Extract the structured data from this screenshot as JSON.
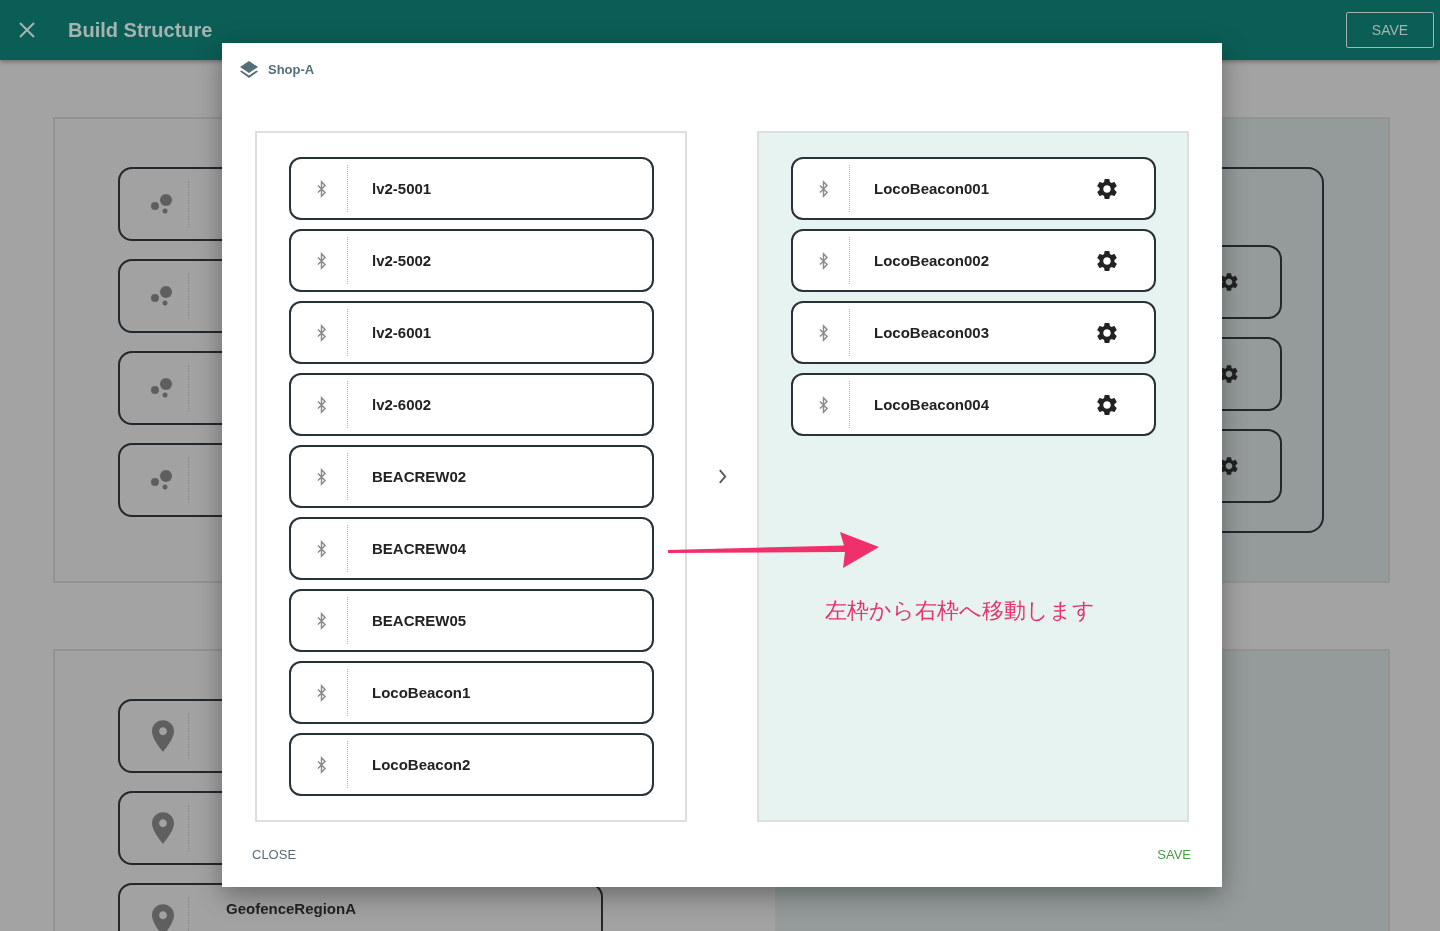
{
  "app_bar": {
    "title": "Build Structure",
    "save_button": "SAVE"
  },
  "background": {
    "group_cards": [
      {
        "kind": "group"
      },
      {
        "kind": "group"
      },
      {
        "kind": "group"
      },
      {
        "kind": "group"
      }
    ],
    "settings_cards": [
      {
        "kind": "settings"
      },
      {
        "kind": "settings"
      },
      {
        "kind": "settings"
      }
    ],
    "geofence_cards": [
      {
        "kind": "geofence"
      },
      {
        "kind": "geofence"
      },
      {
        "kind": "geofence",
        "name": "GeofenceRegionA"
      }
    ]
  },
  "dialog": {
    "title": "Shop-A",
    "available_beacons": [
      {
        "name": "lv2-5001"
      },
      {
        "name": "lv2-5002"
      },
      {
        "name": "lv2-6001"
      },
      {
        "name": "lv2-6002"
      },
      {
        "name": "BEACREW02"
      },
      {
        "name": "BEACREW04"
      },
      {
        "name": "BEACREW05"
      },
      {
        "name": "LocoBeacon1"
      },
      {
        "name": "LocoBeacon2"
      }
    ],
    "assigned_beacons": [
      {
        "name": "LocoBeacon001"
      },
      {
        "name": "LocoBeacon002"
      },
      {
        "name": "LocoBeacon003"
      },
      {
        "name": "LocoBeacon004"
      }
    ],
    "annotation": "左枠から右枠へ移動します",
    "close_button": "CLOSE",
    "save_button": "SAVE"
  }
}
